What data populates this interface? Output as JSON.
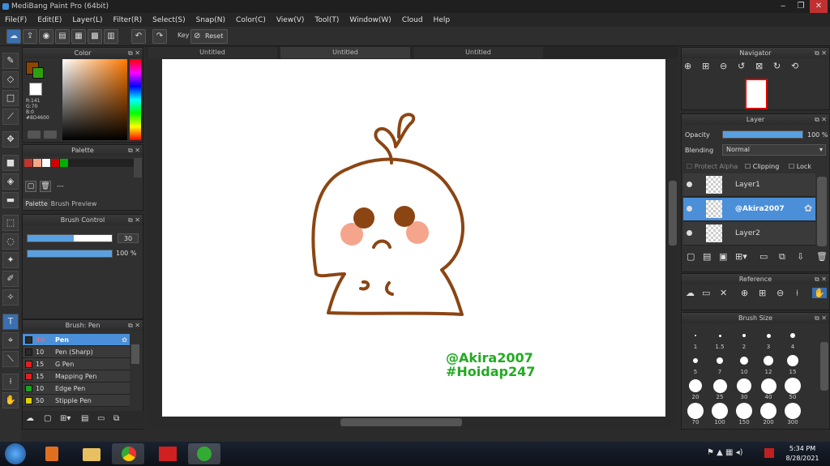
{
  "window": {
    "title": "MediBang Paint Pro (64bit)",
    "minimize": "‒",
    "restore": "❐",
    "close": "✕"
  },
  "menu": [
    "File(F)",
    "Edit(E)",
    "Layer(L)",
    "Filter(R)",
    "Select(S)",
    "Snap(N)",
    "Color(C)",
    "View(V)",
    "Tool(T)",
    "Window(W)",
    "Cloud",
    "Help"
  ],
  "toolbar": {
    "key_label": "Key",
    "reset_label": "Reset"
  },
  "tabs": [
    "Untitled",
    "Untitled",
    "Untitled"
  ],
  "color_panel": {
    "title": "Color",
    "r": "R:141",
    "g": "G:70",
    "b": "B:0",
    "hex": "#8D4600",
    "main_color": "#8D4600",
    "sub_color": "#2ea010"
  },
  "palette_panel": {
    "title": "Palette",
    "tab1": "Palette",
    "tab2": "Brush Preview",
    "name": "---",
    "colors": [
      "#c0362c",
      "#f3a88a",
      "#ffffff",
      "#d00000",
      "#00b000"
    ]
  },
  "brush_control": {
    "title": "Brush Control",
    "size": "30",
    "opacity": "100 %",
    "size_fill": 0.55,
    "opacity_fill": 1.0
  },
  "brush_panel": {
    "title": "Brush: Pen",
    "items": [
      {
        "size": "30",
        "name": "Pen",
        "color": "#2a2a2a",
        "selected": true
      },
      {
        "size": "10",
        "name": "Pen (Sharp)",
        "color": "#2a2a2a"
      },
      {
        "size": "15",
        "name": "G Pen",
        "color": "#e02020"
      },
      {
        "size": "15",
        "name": "Mapping Pen",
        "color": "#e02020"
      },
      {
        "size": "10",
        "name": "Edge Pen",
        "color": "#20a020"
      },
      {
        "size": "50",
        "name": "Stipple Pen",
        "color": "#e0d000"
      }
    ]
  },
  "canvas": {
    "watermark1": "@Akira2007",
    "watermark2": "#Hoidap247",
    "stroke": "#8B4513",
    "cheek": "#f4a58c"
  },
  "navigator": {
    "title": "Navigator"
  },
  "layer_panel": {
    "title": "Layer",
    "opacity_label": "Opacity",
    "opacity_value": "100 %",
    "blending_label": "Blending",
    "blending_value": "Normal",
    "protect_alpha": "Protect Alpha",
    "clipping": "Clipping",
    "lock": "Lock",
    "layers": [
      {
        "name": "Layer1"
      },
      {
        "name": "@Akira2007",
        "selected": true
      },
      {
        "name": "Layer2"
      }
    ]
  },
  "reference_panel": {
    "title": "Reference"
  },
  "brush_size_panel": {
    "title": "Brush Size",
    "sizes": [
      "1",
      "1.5",
      "2",
      "3",
      "4",
      "5",
      "7",
      "10",
      "12",
      "15",
      "20",
      "25",
      "30",
      "40",
      "50",
      "70",
      "100",
      "150",
      "200",
      "300"
    ]
  },
  "clock": {
    "time": "5:34 PM",
    "date": "8/28/2021"
  }
}
